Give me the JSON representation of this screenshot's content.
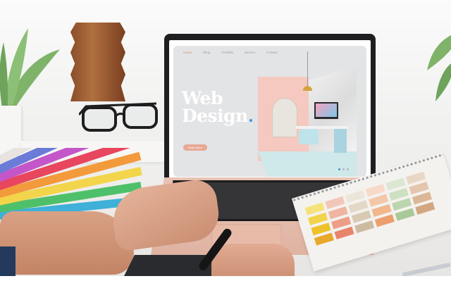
{
  "website": {
    "nav": [
      "Home",
      "Shop",
      "Portfolio",
      "Service",
      "Contact"
    ],
    "hero_title_line1": "Web",
    "hero_title_line2": "Design",
    "hero_subtitle": "",
    "cta_label": "Read More"
  },
  "colors": {
    "accent_salmon": "#e7a894",
    "pink_wall": "#f5c9bf",
    "pager_active": "#4a90d9",
    "laptop_rose_gold": "#e9c3b4"
  },
  "icons": [
    "plant",
    "eyeglasses",
    "color-swatch-fan",
    "pendant-lamp",
    "pen",
    "drawing-tablet",
    "spiral-notepad"
  ]
}
